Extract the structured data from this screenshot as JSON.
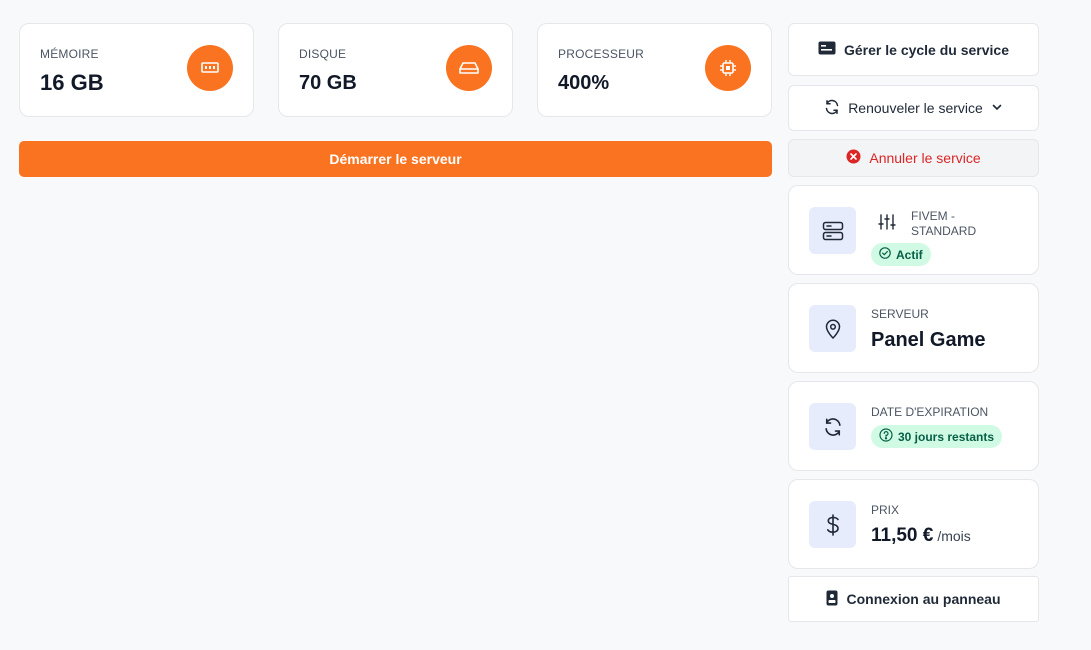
{
  "stats": [
    {
      "label": "MÉMOIRE",
      "value": "16 GB",
      "icon": "memory-icon"
    },
    {
      "label": "DISQUE",
      "value": "70 GB",
      "icon": "disk-icon"
    },
    {
      "label": "PROCESSEUR",
      "value": "400%",
      "icon": "cpu-icon"
    }
  ],
  "start_button": "Démarrer le serveur",
  "actions": {
    "manage_cycle": "Gérer le cycle du service",
    "renew": "Renouveler le service",
    "cancel": "Annuler le service",
    "panel_login": "Connexion au panneau"
  },
  "product": {
    "line1": "FIVEM -",
    "line2": "STANDARD",
    "status": "Actif"
  },
  "server": {
    "label": "SERVEUR",
    "value": "Panel Game"
  },
  "expiration": {
    "label": "DATE D'EXPIRATION",
    "remaining": "30 jours restants"
  },
  "price": {
    "label": "PRIX",
    "value": "11,50 €",
    "unit": "/mois"
  },
  "colors": {
    "accent": "#f97320",
    "danger": "#dc2626",
    "success_bg": "#d1fae5",
    "icon_bg": "#e6ecfb"
  }
}
